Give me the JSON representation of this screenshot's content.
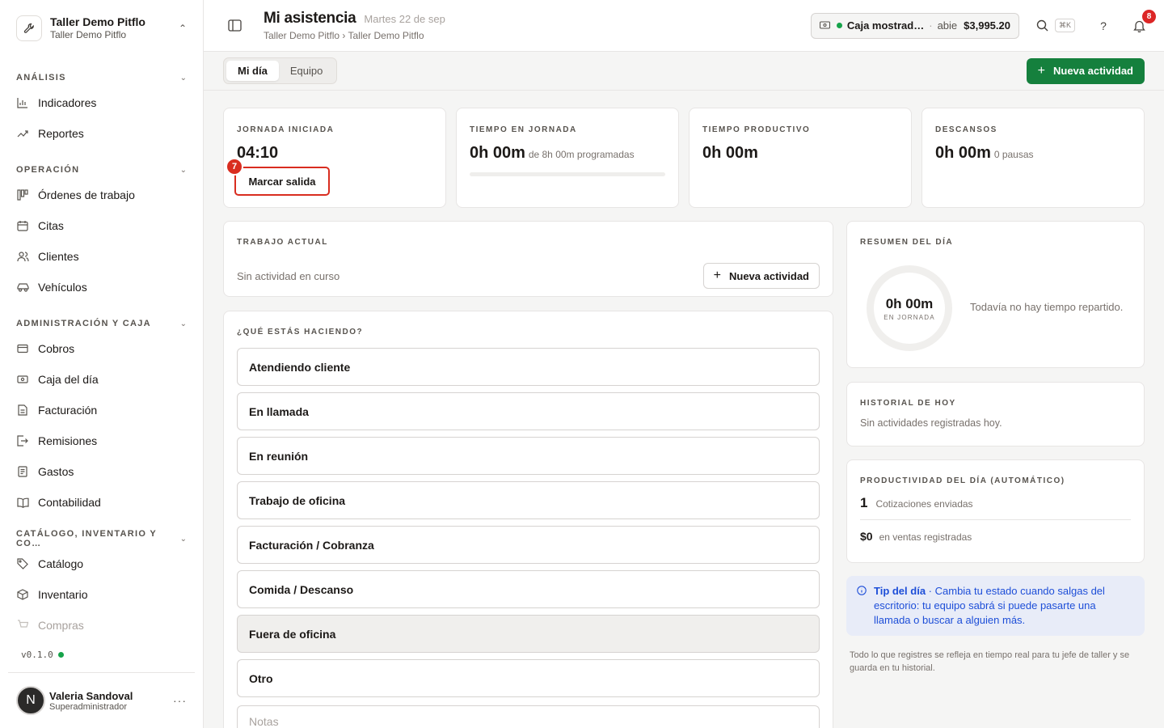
{
  "org": {
    "name": "Taller Demo Pitflo",
    "sub": "Taller Demo Pitflo"
  },
  "sidebar": {
    "sections": [
      {
        "title": "ANÁLISIS",
        "items": [
          "Indicadores",
          "Reportes"
        ]
      },
      {
        "title": "OPERACIÓN",
        "items": [
          "Órdenes de trabajo",
          "Citas",
          "Clientes",
          "Vehículos"
        ]
      },
      {
        "title": "ADMINISTRACIÓN Y CAJA",
        "items": [
          "Cobros",
          "Caja del día",
          "Facturación",
          "Remisiones",
          "Gastos",
          "Contabilidad"
        ]
      },
      {
        "title": "CATÁLOGO, INVENTARIO Y CO…",
        "items": [
          "Catálogo",
          "Inventario",
          "Compras"
        ]
      }
    ],
    "version": "v0.1.0",
    "user": {
      "initial": "N",
      "name": "Valeria Sandoval",
      "role": "Superadministrador"
    }
  },
  "header": {
    "title": "Mi asistencia",
    "date": "Martes 22 de sep",
    "breadcrumb": "Taller Demo Pitflo › Taller Demo Pitflo",
    "cashbox": {
      "name": "Caja mostrad…",
      "sep": "·",
      "status": "abie",
      "amount": "$3,995.20"
    },
    "kbd": "⌘K",
    "help": "?",
    "notifications": "8"
  },
  "tabs": [
    "Mi día",
    "Equipo"
  ],
  "primary_action": "Nueva actividad",
  "stats": [
    {
      "label": "JORNADA INICIADA",
      "value": "04:10",
      "button": "Marcar salida",
      "step": "7"
    },
    {
      "label": "TIEMPO EN JORNADA",
      "value": "0h 00m",
      "note": "de 8h 00m programadas",
      "progress": 0
    },
    {
      "label": "TIEMPO PRODUCTIVO",
      "value": "0h 00m"
    },
    {
      "label": "DESCANSOS",
      "value": "0h 00m",
      "note": "0 pausas"
    }
  ],
  "current": {
    "label": "TRABAJO ACTUAL",
    "empty": "Sin actividad en curso",
    "button": "Nueva actividad"
  },
  "doing": {
    "label": "¿QUÉ ESTÁS HACIENDO?",
    "options": [
      "Atendiendo cliente",
      "En llamada",
      "En reunión",
      "Trabajo de oficina",
      "Facturación / Cobranza",
      "Comida / Descanso",
      "Fuera de oficina",
      "Otro"
    ],
    "notes_placeholder": "Notas"
  },
  "summary": {
    "label": "RESUMEN DEL DÍA",
    "value": "0h 00m",
    "sub": "EN JORNADA",
    "empty": "Todavía no hay tiempo repartido."
  },
  "history": {
    "label": "HISTORIAL DE HOY",
    "empty": "Sin actividades registradas hoy."
  },
  "productivity": {
    "label": "PRODUCTIVIDAD DEL DÍA (AUTOMÁTICO)",
    "quotes_count": "1",
    "quotes_label": "Cotizaciones enviadas",
    "sales_amount": "$0",
    "sales_label": "en ventas registradas"
  },
  "tip": {
    "title": "Tip del día",
    "text": " · Cambia tu estado cuando salgas del escritorio: tu equipo sabrá si puede pasarte una llamada o buscar a alguien más."
  },
  "footnote": "Todo lo que registres se refleja en tiempo real para tu jefe de taller y se guarda en tu historial.",
  "colors": {
    "accent": "#15803d",
    "danger": "#d92d20",
    "tip_bg": "#e8ecf8",
    "tip_text": "#1d4ed8"
  }
}
